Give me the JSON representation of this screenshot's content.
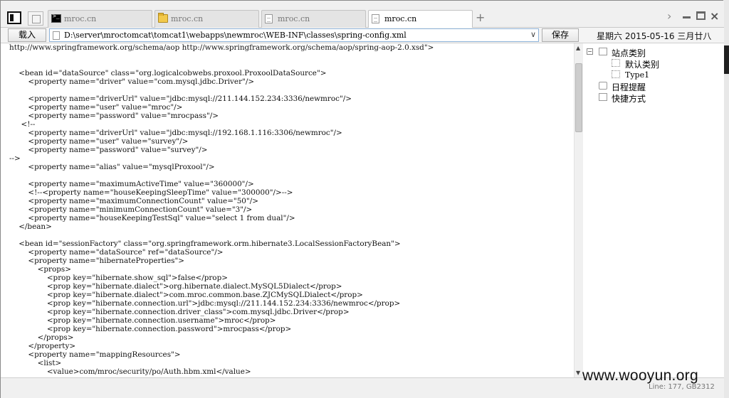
{
  "tabs": [
    {
      "label": "mroc.cn",
      "icon": "terminal-icon",
      "active": false
    },
    {
      "label": "mroc.cn",
      "icon": "folder-icon",
      "active": false
    },
    {
      "label": "mroc.cn",
      "icon": "document-icon",
      "active": false
    },
    {
      "label": "mroc.cn",
      "icon": "document-icon",
      "active": true
    }
  ],
  "tabbar": {
    "add_tab": "+",
    "chevron": "›",
    "close": "×"
  },
  "toolbar": {
    "load_label": "载入",
    "path_value": "D:\\server\\mroctomcat\\tomcat1\\webapps\\newmroc\\WEB-INF\\classes\\spring-config.xml",
    "dropdown": "∨",
    "save_label": "保存",
    "date": "星期六 2015-05-16 三月廿八"
  },
  "editor": {
    "lines": [
      "http://www.springframework.org/schema/aop http://www.springframework.org/schema/aop/spring-aop-2.0.xsd\">",
      "",
      "",
      "    <bean id=\"dataSource\" class=\"org.logicalcobwebs.proxool.ProxoolDataSource\">",
      "        <property name=\"driver\" value=\"com.mysql.jdbc.Driver\"/>",
      "",
      "        <property name=\"driverUrl\" value=\"jdbc:mysql://211.144.152.234:3336/newmroc\"/>",
      "        <property name=\"user\" value=\"mroc\"/>",
      "        <property name=\"password\" value=\"mrocpass\"/>",
      "     <!--",
      "        <property name=\"driverUrl\" value=\"jdbc:mysql://192.168.1.116:3306/newmroc\"/>",
      "        <property name=\"user\" value=\"survey\"/>",
      "        <property name=\"password\" value=\"survey\"/>",
      "-->",
      "        <property name=\"alias\" value=\"mysqlProxool\"/>",
      "",
      "        <property name=\"maximumActiveTime\" value=\"360000\"/>",
      "        <!--<property name=\"houseKeepingSleepTime\" value=\"300000\"/>-->",
      "        <property name=\"maximumConnectionCount\" value=\"50\"/>",
      "        <property name=\"minimumConnectionCount\" value=\"3\"/>",
      "        <property name=\"houseKeepingTestSql\" value=\"select 1 from dual\"/>",
      "    </bean>",
      "",
      "    <bean id=\"sessionFactory\" class=\"org.springframework.orm.hibernate3.LocalSessionFactoryBean\">",
      "        <property name=\"dataSource\" ref=\"dataSource\"/>",
      "        <property name=\"hibernateProperties\">",
      "            <props>",
      "                <prop key=\"hibernate.show_sql\">false</prop>",
      "                <prop key=\"hibernate.dialect\">org.hibernate.dialect.MySQL5Dialect</prop>",
      "                <prop key=\"hibernate.dialect\">com.mroc.common.base.ZJCMySQLDialect</prop>",
      "                <prop key=\"hibernate.connection.url\">jdbc:mysql://211.144.152.234:3336/newmroc</prop>",
      "                <prop key=\"hibernate.connection.driver_class\">com.mysql.jdbc.Driver</prop>",
      "                <prop key=\"hibernate.connection.username\">mroc</prop>",
      "                <prop key=\"hibernate.connection.password\">mrocpass</prop>",
      "            </props>",
      "        </property>",
      "        <property name=\"mappingResources\">",
      "            <list>",
      "                <value>com/mroc/security/po/Auth.hbm.xml</value>"
    ]
  },
  "tree": {
    "root": {
      "label": "站点类别",
      "expander": "−"
    },
    "children": [
      {
        "label": "默认类别"
      },
      {
        "label": "Type1"
      }
    ],
    "schedule": {
      "label": "日程提醒"
    },
    "shortcuts": {
      "label": "快捷方式"
    }
  },
  "scrollbar": {
    "up": "▲",
    "down": "▼"
  },
  "status": {
    "text": "Line: 177, GB2312"
  },
  "watermark": "www.wooyun.org"
}
